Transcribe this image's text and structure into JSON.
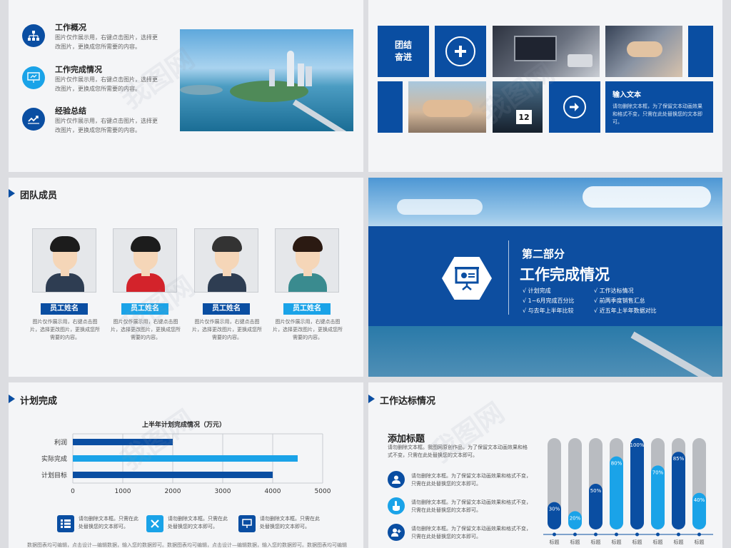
{
  "p1": {
    "items": [
      {
        "title": "工作概况",
        "desc": "图片仅作展示用，右键点击图片，选择更改图片，更换成您所需要的内容。"
      },
      {
        "title": "工作完成情况",
        "desc": "图片仅作展示用，右键点击图片，选择更改图片，更换成您所需要的内容。"
      },
      {
        "title": "经验总结",
        "desc": "图片仅作展示用，右键点击图片，选择更改图片，更换成您所需要的内容。"
      }
    ]
  },
  "p2": {
    "tile_text": "团结\n奋进",
    "input_title": "输入文本",
    "input_desc": "请勿删除文本框，为了保留文本动画效果和格式不变，只需在此处替换您的文本即可。",
    "badge": "12"
  },
  "p3": {
    "title": "团队成员",
    "members": [
      {
        "name": "员工姓名",
        "desc": "图片仅作展示用，右键点击图片，选择更改图片，更换成您所需要的内容。"
      },
      {
        "name": "员工姓名",
        "desc": "图片仅作展示用，右键点击图片，选择更改图片，更换成您所需要的内容。"
      },
      {
        "name": "员工姓名",
        "desc": "图片仅作展示用，右键点击图片，选择更改图片，更换成您所需要的内容。"
      },
      {
        "name": "员工姓名",
        "desc": "图片仅作展示用，右键点击图片，选择更改图片，更换成您所需要的内容。"
      }
    ]
  },
  "p4": {
    "part": "第二部分",
    "title": "工作完成情况",
    "bullets": [
      "√ 计划完成",
      "√ 工作达标情况",
      "√ 1~6月完成百分比",
      "√ 前两季度销售汇总",
      "√ 与去年上半年比较",
      "√ 近五年上半年数据对比"
    ]
  },
  "p5": {
    "title": "计划完成",
    "notes": [
      {
        "text": "请勿删除文本框。只需在此处替换您的文本即可。"
      },
      {
        "text": "请勿删除文本框。只需在此处替换您的文本即可。"
      },
      {
        "text": "请勿删除文本框。只需在此处替换您的文本即可。"
      }
    ],
    "footer": "数据图表均可编辑，点击设计—编辑数据，输入您的数据即可。数据图表均可编辑，点击设计—编辑数据，输入您的数据即可。数据图表均可编辑"
  },
  "p6": {
    "title": "工作达标情况",
    "sub_title": "添加标题",
    "sub_desc": "请勿删除文本框。我图网原创作品，为了保留文本动画效果和格式不变，只需在此处替换您的文本即可。",
    "items": [
      {
        "text": "请勿删除文本框。为了保留文本动画效果和格式不变，只需在此处替换您的文本即可。"
      },
      {
        "text": "请勿删除文本框。为了保留文本动画效果和格式不变，只需在此处替换您的文本即可。"
      },
      {
        "text": "请勿删除文本框。为了保留文本动画效果和格式不变，只需在此处替换您的文本即可。"
      }
    ]
  },
  "chart_data": [
    {
      "type": "bar",
      "orientation": "horizontal",
      "title": "上半年计划完成情况（万元）",
      "categories": [
        "利润",
        "实际完成",
        "计划目标"
      ],
      "values": [
        2000,
        4500,
        4000
      ],
      "xlim": [
        0,
        5000
      ],
      "xticks": [
        0,
        1000,
        2000,
        3000,
        4000,
        5000
      ],
      "colors": [
        "#0a4ea2",
        "#1aa3e8",
        "#0a4ea2"
      ],
      "grid": true
    },
    {
      "type": "bar",
      "categories": [
        "标题",
        "标题",
        "标题",
        "标题",
        "标题",
        "标题",
        "标题",
        "标题"
      ],
      "values": [
        30,
        20,
        50,
        80,
        100,
        70,
        85,
        40
      ],
      "labels": [
        "30%",
        "20%",
        "50%",
        "80%",
        "100%",
        "70%",
        "85%",
        "40%"
      ],
      "ylim": [
        0,
        100
      ],
      "colors": [
        "#0a4ea2",
        "#1aa3e8",
        "#0a4ea2",
        "#1aa3e8",
        "#0a4ea2",
        "#1aa3e8",
        "#0a4ea2",
        "#1aa3e8"
      ],
      "track_color": "#b9bcc1"
    }
  ]
}
